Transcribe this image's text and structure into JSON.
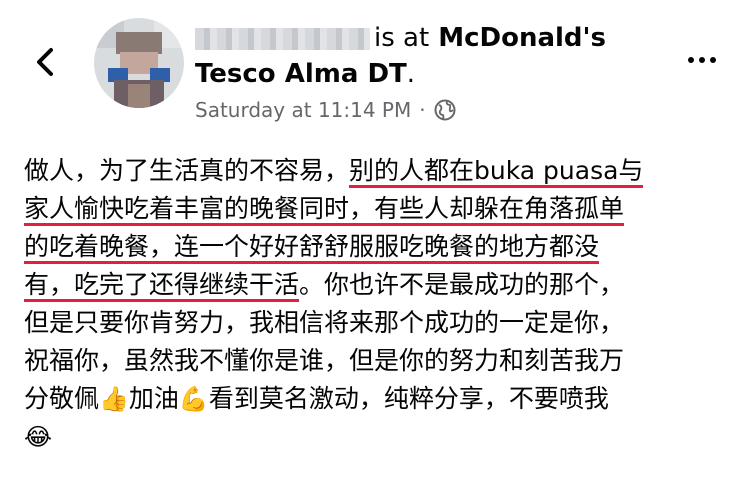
{
  "header": {
    "author_suffix": "is at",
    "place_line1": "McDonald's",
    "place_line2": "Tesco Alma DT",
    "place_end": ".",
    "timestamp": "Saturday at 11:14 PM",
    "separator": "·",
    "icons": {
      "back": "chevron-left-icon",
      "privacy": "globe-icon",
      "more": "more-icon"
    }
  },
  "post": {
    "lines": [
      {
        "plain": "做人，为了生活真的不容易，",
        "highlight": "别的人都在buka puasa与"
      },
      {
        "highlight": "家人愉快吃着丰富的晚餐同时，有些人却躲在角落孤单"
      },
      {
        "highlight": "的吃着晚餐，连一个好好舒舒服服吃晚餐的地方都没"
      },
      {
        "highlight": "有，吃完了还得继续干活",
        "plain": "。你也许不是最成功的那个，"
      },
      {
        "plain": "但是只要你肯努力，我相信将来那个成功的一定是你，"
      },
      {
        "plain": "祝福你，虽然我不懂你是谁，但是你的努力和刻苦我万"
      },
      {
        "plain1": "分敬佩",
        "emoji1": "👍",
        "plain2": "加油",
        "emoji2": "💪",
        "plain3": "看到莫名激动，纯粹分享，不要喷我"
      },
      {
        "emoji": "😂"
      }
    ],
    "highlight_color": "#e41e3f"
  }
}
